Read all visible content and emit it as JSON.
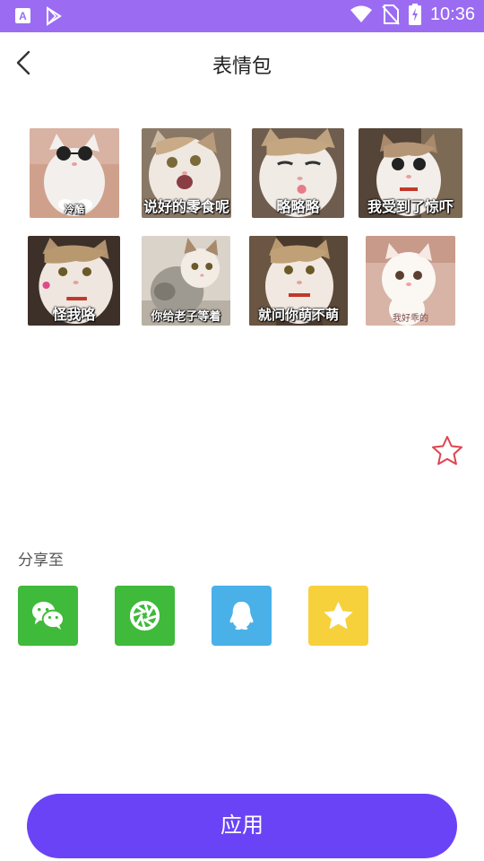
{
  "status_bar": {
    "time": "10:36",
    "icons": [
      "a-app-icon",
      "play-store-icon",
      "wifi-icon",
      "no-sim-icon",
      "battery-charging-icon"
    ]
  },
  "header": {
    "title": "表情包",
    "back_icon": "chevron-left-icon"
  },
  "stickers": [
    {
      "caption": "冷酷"
    },
    {
      "caption": "说好的零食呢"
    },
    {
      "caption": "略略略"
    },
    {
      "caption": "我受到了惊吓"
    },
    {
      "caption": "怪我咯"
    },
    {
      "caption": "你给老子等着"
    },
    {
      "caption": "就问你萌不萌"
    },
    {
      "caption": "我好乖的"
    }
  ],
  "favorite": {
    "icon": "star-outline-icon",
    "color": "#e0434f"
  },
  "share": {
    "label": "分享至",
    "targets": [
      {
        "icon": "wechat-icon",
        "color": "#3fba3a"
      },
      {
        "icon": "moments-icon",
        "color": "#3fba3a"
      },
      {
        "icon": "qq-icon",
        "color": "#4ab0e8"
      },
      {
        "icon": "favorites-star-icon",
        "color": "#f7d13c"
      }
    ]
  },
  "apply_button": {
    "label": "应用",
    "color": "#6a43f6"
  }
}
